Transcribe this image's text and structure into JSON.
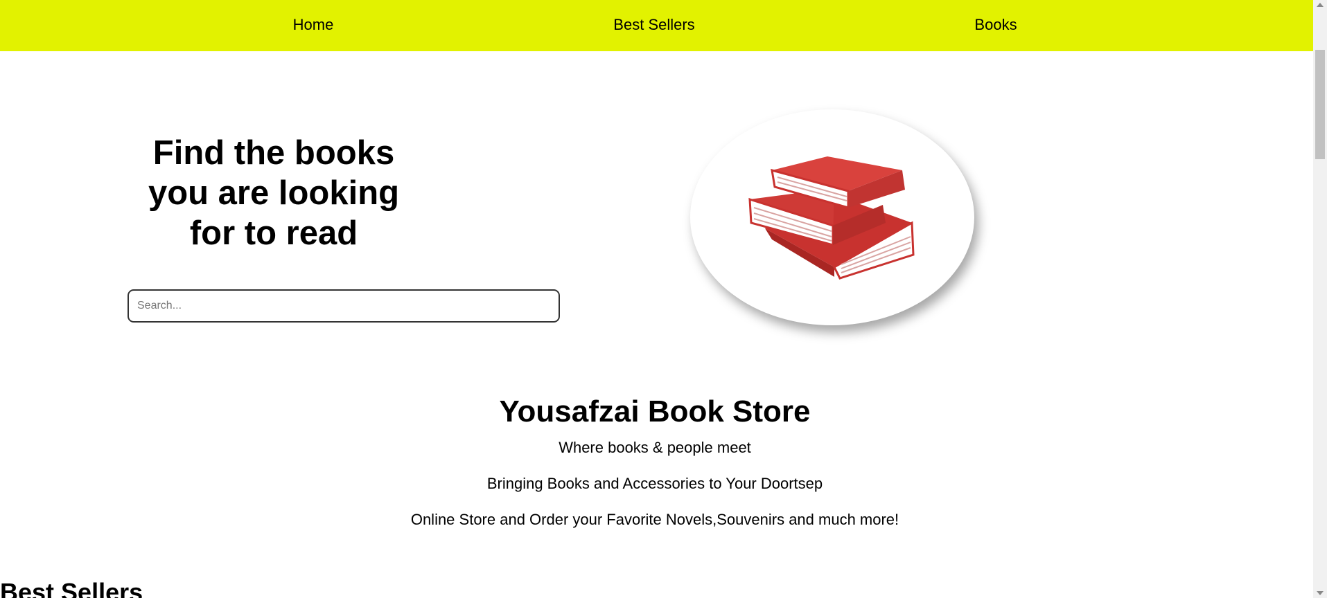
{
  "nav": {
    "items": [
      {
        "label": "Home"
      },
      {
        "label": "Best Sellers"
      },
      {
        "label": "Books"
      }
    ],
    "background_color": "#e2f200"
  },
  "hero": {
    "title": "Find the books you are looking for to read",
    "search_placeholder": "Search...",
    "search_value": "",
    "image_icon": "stack-of-books-icon",
    "image_color": "#d53a35"
  },
  "intro": {
    "store_name": "Yousafzai Book Store",
    "tagline": "Where books & people meet",
    "line2": "Bringing Books and Accessories to Your Doortsep",
    "line3": "Online Store and Order your Favorite Novels,Souvenirs and much more!"
  },
  "best_sellers": {
    "heading": "Best Sellers"
  }
}
